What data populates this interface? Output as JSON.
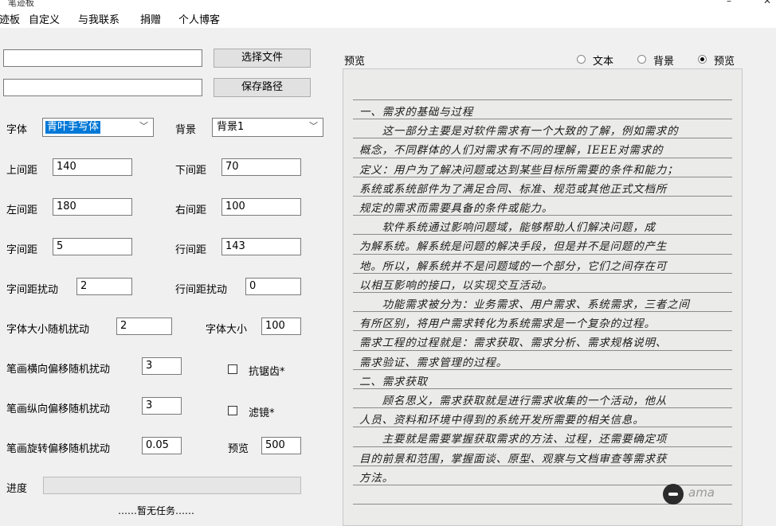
{
  "window": {
    "title": "笔迹板",
    "controls": {
      "min": "–",
      "close": "✕"
    }
  },
  "menu": [
    "字迹板",
    "自定义",
    "与我联系",
    "捐赠",
    "个人博客"
  ],
  "file": {
    "path1_value": "",
    "path2_value": "",
    "choose_btn": "选择文件",
    "save_btn": "保存路径"
  },
  "font": {
    "label": "字体",
    "value": "青叶手写体"
  },
  "background": {
    "label": "背景",
    "value": "背景1"
  },
  "fields": {
    "top_margin": {
      "label": "上间距",
      "value": "140"
    },
    "bottom_margin": {
      "label": "下间距",
      "value": "70"
    },
    "left_margin": {
      "label": "左间距",
      "value": "180"
    },
    "right_margin": {
      "label": "右间距",
      "value": "100"
    },
    "char_spacing": {
      "label": "字间距",
      "value": "5"
    },
    "line_spacing": {
      "label": "行间距",
      "value": "143"
    },
    "char_spacing_jitter": {
      "label": "字间距扰动",
      "value": "2"
    },
    "line_spacing_jitter": {
      "label": "行间距扰动",
      "value": "0"
    },
    "font_size_jitter": {
      "label": "字体大小随机扰动",
      "value": "2"
    },
    "font_size": {
      "label": "字体大小",
      "value": "100"
    },
    "stroke_h_jitter": {
      "label": "笔画横向偏移随机扰动",
      "value": "3"
    },
    "stroke_v_jitter": {
      "label": "笔画纵向偏移随机扰动",
      "value": "3"
    },
    "stroke_rot_jitter": {
      "label": "笔画旋转偏移随机扰动",
      "value": "0.05"
    },
    "preview_size": {
      "label": "预览",
      "value": "500"
    }
  },
  "checkboxes": {
    "antialias": {
      "label": "抗锯齿*",
      "checked": false
    },
    "filter": {
      "label": "滤镜*",
      "checked": false
    }
  },
  "progress": {
    "label": "进度",
    "value": 0,
    "fill_color": "#06b025"
  },
  "status": "……暂无任务……",
  "preview": {
    "label": "预览",
    "radios": [
      {
        "label": "文本",
        "selected": false
      },
      {
        "label": "背景",
        "selected": false
      },
      {
        "label": "预览",
        "selected": true
      }
    ],
    "paper_color": "#ebebea",
    "lines": [
      "一、需求的基础与过程",
      "　　这一部分主要是对软件需求有一个大致的了解，例如需求的",
      "概念，不同群体的人们对需求有不同的理解，IEEE对需求的",
      "定义：用户为了解决问题或达到某些目标所需要的条件和能力；",
      "系统或系统部件为了满足合同、标准、规范或其他正式文档所",
      "规定的需求而需要具备的条件或能力。",
      "　　软件系统通过影响问题域，能够帮助人们解决问题，成",
      "为解系统。解系统是问题的解决手段，但是并不是问题的产生",
      "地。所以，解系统并不是问题域的一个部分，它们之间存在可",
      "以相互影响的接口，以实现交互活动。",
      "　　功能需求被分为：业务需求、用户需求、系统需求，三者之间",
      "有所区别，将用户需求转化为系统需求是一个复杂的过程。",
      "需求工程的过程就是：需求获取、需求分析、需求规格说明、",
      "需求验证、需求管理的过程。",
      "二、需求获取",
      "　　顾名思义，需求获取就是进行需求收集的一个活动，他从",
      "人员、资料和环境中得到的系统开发所需要的相关信息。",
      "　　主要就是需要掌握获取需求的方法、过程，还需要确定项",
      "目的前景和范围，掌握面谈、原型、观察与文档审查等需求获",
      "方法。"
    ]
  },
  "watermark": "ama"
}
